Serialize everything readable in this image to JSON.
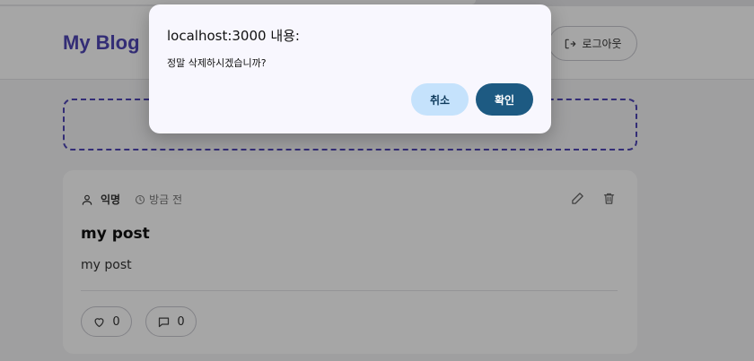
{
  "header": {
    "brand": "My Blog",
    "logout_label": "로그아웃"
  },
  "post": {
    "author": "익명",
    "time": "방금 전",
    "title": "my post",
    "body": "my post",
    "likes": "0",
    "comments": "0"
  },
  "dialog": {
    "title": "localhost:3000 내용:",
    "message": "정말 삭제하시겠습니까?",
    "cancel_label": "취소",
    "ok_label": "확인"
  },
  "colors": {
    "brand": "#4f46b5",
    "dialog_ok": "#1d5a82",
    "dialog_cancel": "#c5e2fc"
  },
  "icons": [
    "logout-icon",
    "user-icon",
    "clock-icon",
    "edit-icon",
    "trash-icon",
    "heart-icon",
    "comment-icon"
  ]
}
